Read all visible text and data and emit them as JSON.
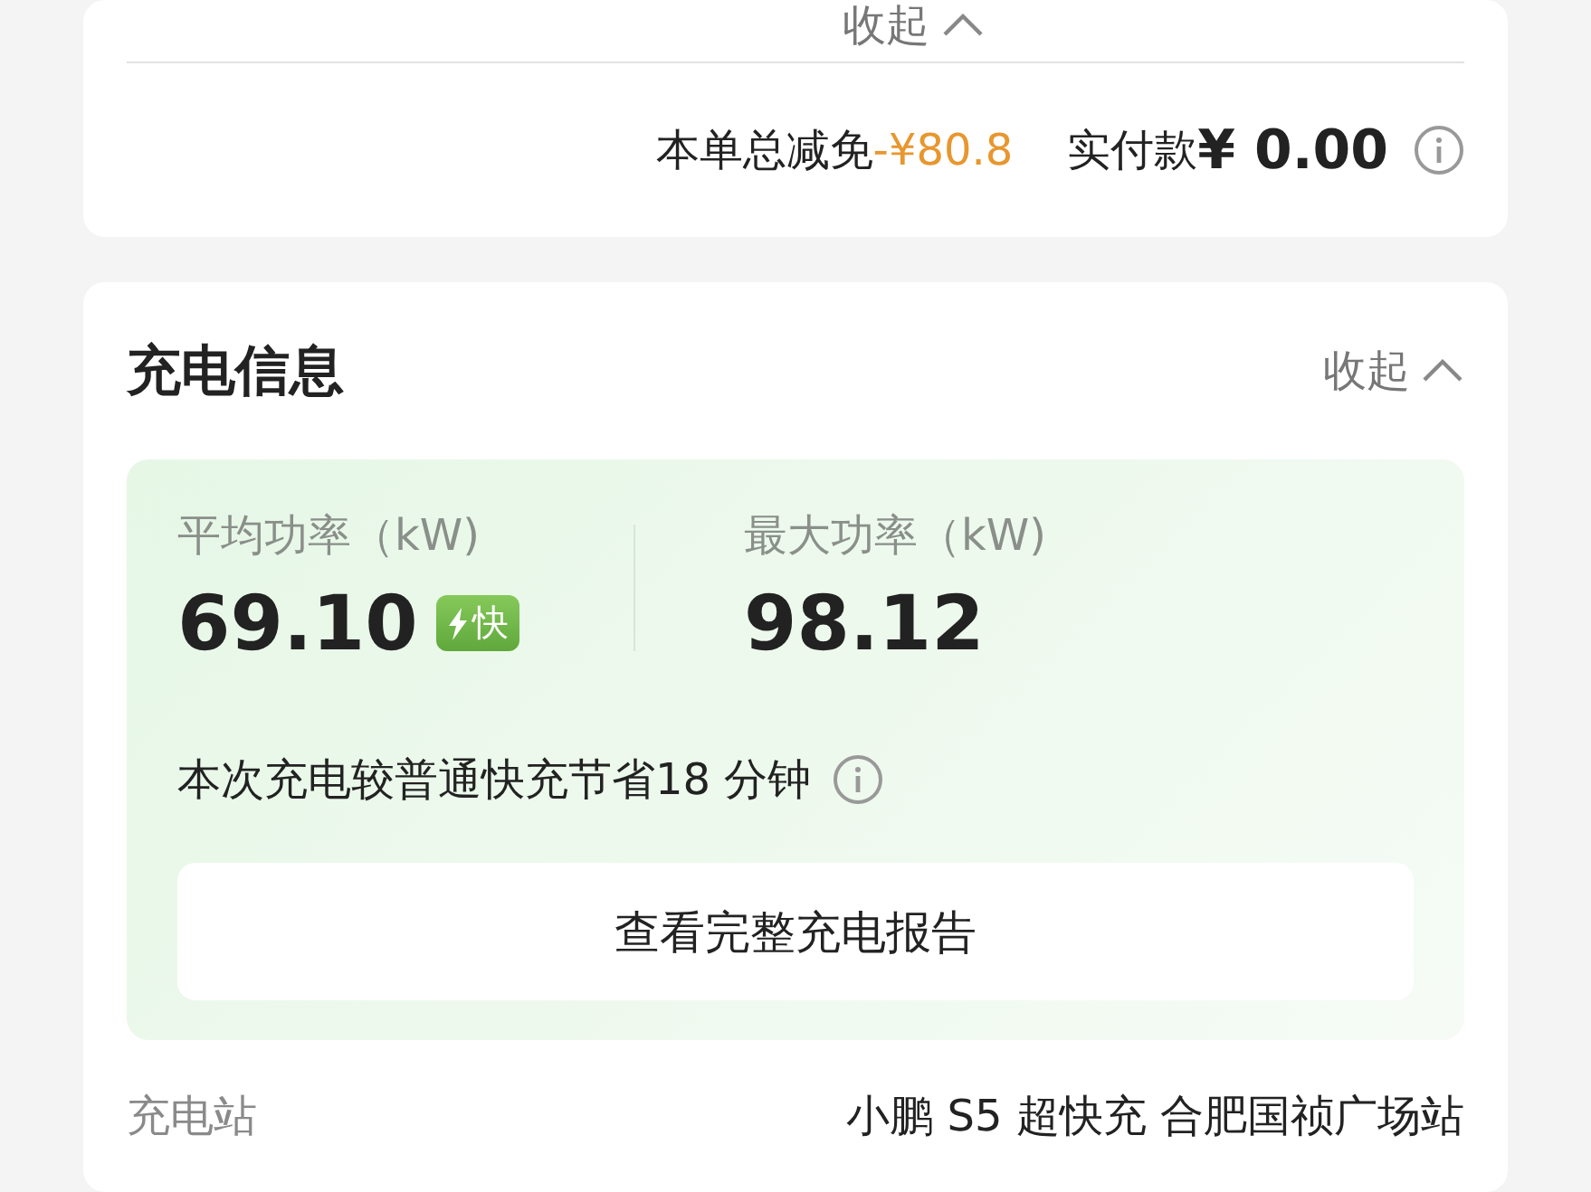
{
  "payment_card": {
    "collapse": {
      "label": "收起",
      "expanded": true
    },
    "discount_label": "本单总减免",
    "discount_amount": "-¥80.8",
    "paid_label": "实付款",
    "paid_amount": "¥ 0.00"
  },
  "charging_info": {
    "title": "充电信息",
    "collapse": {
      "label": "收起",
      "expanded": true
    },
    "stats": [
      {
        "label": "平均功率（kW)",
        "value": "69.10",
        "badge": "快"
      },
      {
        "label": "最大功率（kW)",
        "value": "98.12"
      }
    ],
    "savings": "本次充电较普通快充节省18 分钟",
    "report_button": "查看完整充电报告",
    "station": {
      "label": "充电站",
      "value": "小鹏 S5 超快充 合肥国祯广场站"
    }
  }
}
